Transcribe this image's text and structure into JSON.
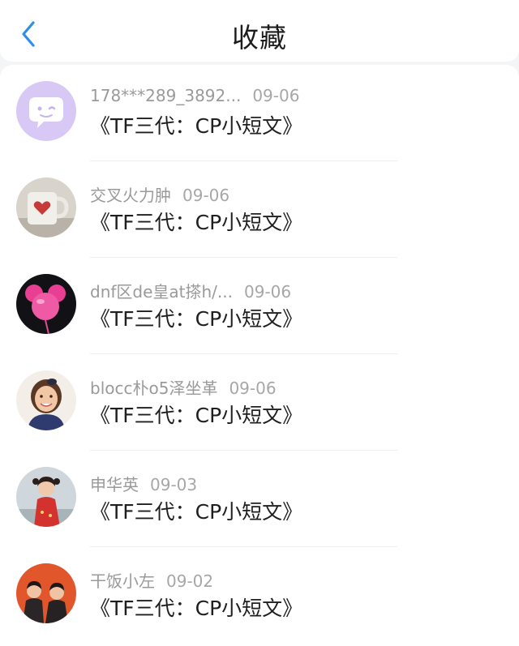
{
  "header": {
    "title": "收藏"
  },
  "items": [
    {
      "user": "178***289_3892...",
      "date": "09-06",
      "title": "《TF三代：CP小短文》",
      "avatar": "purple-chat-face-avatar"
    },
    {
      "user": "交叉火力肿",
      "date": "09-06",
      "title": "《TF三代：CP小短文》",
      "avatar": "heart-mug-avatar"
    },
    {
      "user": "dnf区de皇at搽h/...",
      "date": "09-06",
      "title": "《TF三代：CP小短文》",
      "avatar": "pink-balloon-avatar"
    },
    {
      "user": "blocc朴o5泽坐革",
      "date": "09-06",
      "title": "《TF三代：CP小短文》",
      "avatar": "smiling-girl-avatar"
    },
    {
      "user": "申华英",
      "date": "09-03",
      "title": "《TF三代：CP小短文》",
      "avatar": "girl-red-dress-avatar"
    },
    {
      "user": "干饭小左",
      "date": "09-02",
      "title": "《TF三代：CP小短文》",
      "avatar": "two-boys-orange-avatar"
    }
  ]
}
